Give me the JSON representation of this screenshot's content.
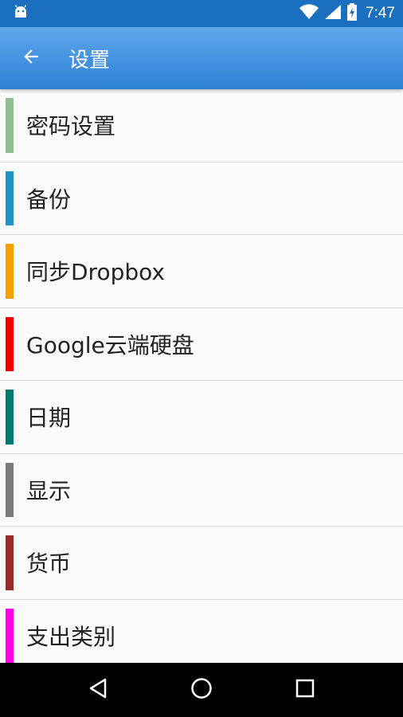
{
  "status_bar": {
    "time": "7:47",
    "icons": [
      "android-icon",
      "wifi-icon",
      "signal-icon",
      "battery-charging-icon"
    ]
  },
  "app_bar": {
    "title": "设置",
    "back_icon": "arrow-left-icon"
  },
  "settings": {
    "items": [
      {
        "label": "密码设置",
        "color": "#8fbf8f"
      },
      {
        "label": "备份",
        "color": "#1f93c4"
      },
      {
        "label": "同步Dropbox",
        "color": "#f5a000"
      },
      {
        "label": "Google云端硬盘",
        "color": "#f20000"
      },
      {
        "label": "日期",
        "color": "#007a70"
      },
      {
        "label": "显示",
        "color": "#7a7a7a"
      },
      {
        "label": "货币",
        "color": "#992a25"
      },
      {
        "label": "支出类别",
        "color": "#ff00e6"
      }
    ]
  },
  "nav_bar": {
    "buttons": [
      "back-triangle-icon",
      "home-circle-icon",
      "recents-square-icon"
    ]
  },
  "colors": {
    "status_bar": "#1a6fbf",
    "app_bar": "#3a8ee0",
    "background": "#fafafa"
  }
}
